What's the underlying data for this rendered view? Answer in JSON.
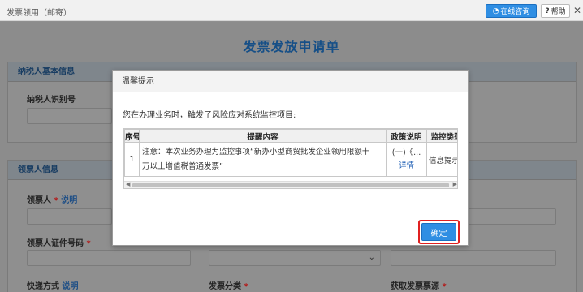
{
  "topbar": {
    "title": "发票领用（邮寄）",
    "chat_label": "在线咨询",
    "help_label": "帮助",
    "help_icon": "?",
    "close_icon": "✕"
  },
  "page": {
    "title": "发票发放申请单",
    "section_taxpayer": "纳税人基本信息",
    "taxpayer_id_label": "纳税人识别号",
    "section_recipient": "领票人信息",
    "recipient_label": "领票人",
    "recipient_link": "说明",
    "recipient_id_label": "领票人证件号码",
    "delivery_label": "快递方式",
    "delivery_link": "说明",
    "invoice_type_label": "发票分类",
    "invoice_source_label": "获取发票票源",
    "required_mark": "*",
    "select_arrow": "⌄"
  },
  "modal": {
    "title": "温馨提示",
    "message": "您在办理业务时，触发了风险应对系统监控项目:",
    "columns": [
      "序号",
      "提醒内容",
      "政策说明",
      "监控类型"
    ],
    "rows": [
      {
        "index": "1",
        "content_line1": "注意：本次业务办理为监控事项“新办小型商贸批发企业领用限额十",
        "content_line2": "万以上增值税普通发票”",
        "policy": "(一)《...",
        "policy_link": "详情",
        "type": "信息提示"
      }
    ],
    "confirm_label": "确定"
  }
}
